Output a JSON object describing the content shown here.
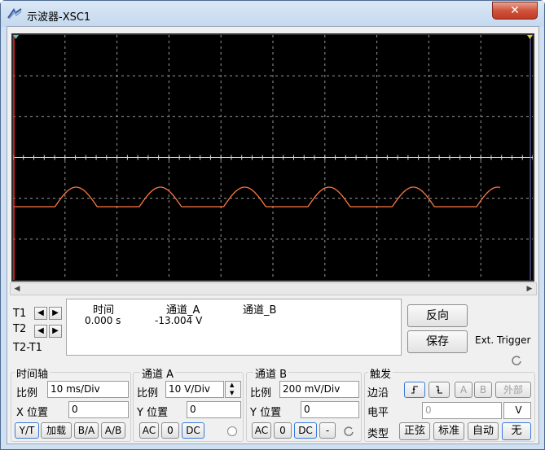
{
  "window": {
    "title": "示波器-XSC1",
    "close_label": "✕"
  },
  "readout": {
    "headers": {
      "time": "时间",
      "channel_a": "通道_A",
      "channel_b": "通道_B"
    },
    "row": {
      "time": "0.000 s",
      "channel_a": "-13.004 V",
      "channel_b": ""
    }
  },
  "cursors": {
    "t1": "T1",
    "t2": "T2",
    "t2t1": "T2-T1"
  },
  "buttons": {
    "reverse": "反向",
    "save": "保存",
    "ext_trigger": "Ext. Trigger"
  },
  "timebase": {
    "title": "时间轴",
    "scale_label": "比例",
    "scale_value": "10 ms/Div",
    "xpos_label": "X 位置",
    "xpos_value": "0",
    "modes": [
      "Y/T",
      "加载",
      "B/A",
      "A/B"
    ]
  },
  "channel_a": {
    "title": "通道 A",
    "scale_label": "比例",
    "scale_value": "10  V/Div",
    "ypos_label": "Y 位置",
    "ypos_value": "0",
    "coupling": [
      "AC",
      "0",
      "DC"
    ]
  },
  "channel_b": {
    "title": "通道 B",
    "scale_label": "比例",
    "scale_value": "200 mV/Div",
    "ypos_label": "Y 位置",
    "ypos_value": "0",
    "coupling": [
      "AC",
      "0",
      "DC",
      "-"
    ]
  },
  "trigger": {
    "title": "触发",
    "edge_label": "边沿",
    "edge_buttons": [
      "A",
      "B",
      "外部"
    ],
    "level_label": "电平",
    "level_value": "0",
    "level_unit": "V",
    "type_label": "类型",
    "types": [
      "正弦",
      "标准",
      "自动",
      "无"
    ]
  },
  "colors": {
    "trace": "#ff7840",
    "cursor_t1": "#ff2a2a",
    "cursor_t2": "#7070c0",
    "grid": "#9a9a9a",
    "screen_bg": "#000000"
  }
}
